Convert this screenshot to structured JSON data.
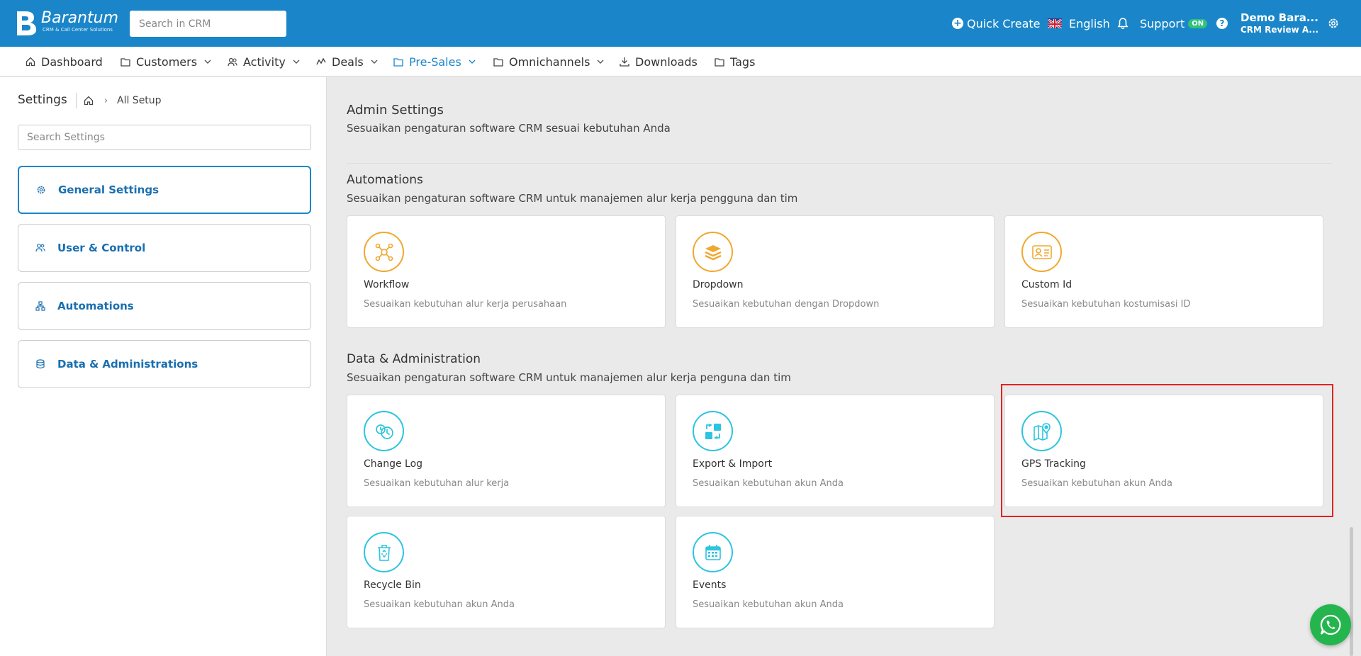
{
  "header": {
    "brand_name": "Barantum",
    "brand_tagline": "CRM & Call Center Solutions",
    "search_placeholder": "Search in CRM",
    "quick_create": "Quick Create",
    "language": "English",
    "support": "Support",
    "support_badge": "ON",
    "user_name": "Demo Bara...",
    "user_role": "CRM Review A..."
  },
  "nav": {
    "items": [
      {
        "label": "Dashboard",
        "icon": "home-icon"
      },
      {
        "label": "Customers",
        "icon": "folder-icon"
      },
      {
        "label": "Activity",
        "icon": "users-icon"
      },
      {
        "label": "Deals",
        "icon": "chart-icon"
      },
      {
        "label": "Pre-Sales",
        "icon": "folder-icon",
        "active": true
      },
      {
        "label": "Omnichannels",
        "icon": "folder-icon"
      },
      {
        "label": "Downloads",
        "icon": "download-icon"
      },
      {
        "label": "Tags",
        "icon": "folder-icon"
      }
    ]
  },
  "sidebar": {
    "title": "Settings",
    "breadcrumb_current": "All Setup",
    "search_placeholder": "Search Settings",
    "items": [
      {
        "label": "General Settings",
        "icon": "gear-icon",
        "active": true
      },
      {
        "label": "User & Control",
        "icon": "users-icon"
      },
      {
        "label": "Automations",
        "icon": "sitemap-icon"
      },
      {
        "label": "Data & Administrations",
        "icon": "database-icon"
      }
    ]
  },
  "main": {
    "title": "Admin Settings",
    "subtitle": "Sesuaikan pengaturan software CRM sesuai kebutuhan Anda",
    "sections": [
      {
        "title": "Automations",
        "subtitle": "Sesuaikan pengaturan software CRM untuk manajemen alur kerja pengguna dan tim",
        "cards": [
          {
            "title": "Workflow",
            "desc": "Sesuaikan kebutuhan alur kerja perusahaan",
            "icon": "workflow-icon"
          },
          {
            "title": "Dropdown",
            "desc": "Sesuaikan kebutuhan dengan Dropdown",
            "icon": "layers-icon"
          },
          {
            "title": "Custom Id",
            "desc": "Sesuaikan kebutuhan kostumisasi ID",
            "icon": "id-card-icon"
          }
        ]
      },
      {
        "title": "Data & Administration",
        "subtitle": "Sesuaikan pengaturan software CRM untuk manajemen alur kerja penguna dan tim",
        "cards": [
          {
            "title": "Change Log",
            "desc": "Sesuaikan kebutuhan alur kerja",
            "icon": "history-icon"
          },
          {
            "title": "Export & Import",
            "desc": "Sesuaikan kebutuhan akun Anda",
            "icon": "transfer-icon"
          },
          {
            "title": "GPS Tracking",
            "desc": "Sesuaikan kebutuhan akun Anda",
            "icon": "map-pin-icon"
          },
          {
            "title": "Recycle Bin",
            "desc": "Sesuaikan kebutuhan akun Anda",
            "icon": "recycle-bin-icon"
          },
          {
            "title": "Events",
            "desc": "Sesuaikan kebutuhan akun Anda",
            "icon": "calendar-icon"
          }
        ]
      }
    ]
  },
  "colors": {
    "primary": "#1a86c9",
    "accent_orange": "#f0a830",
    "accent_cyan": "#2cc4e0",
    "highlight": "#e02424",
    "whatsapp": "#25b54e"
  }
}
